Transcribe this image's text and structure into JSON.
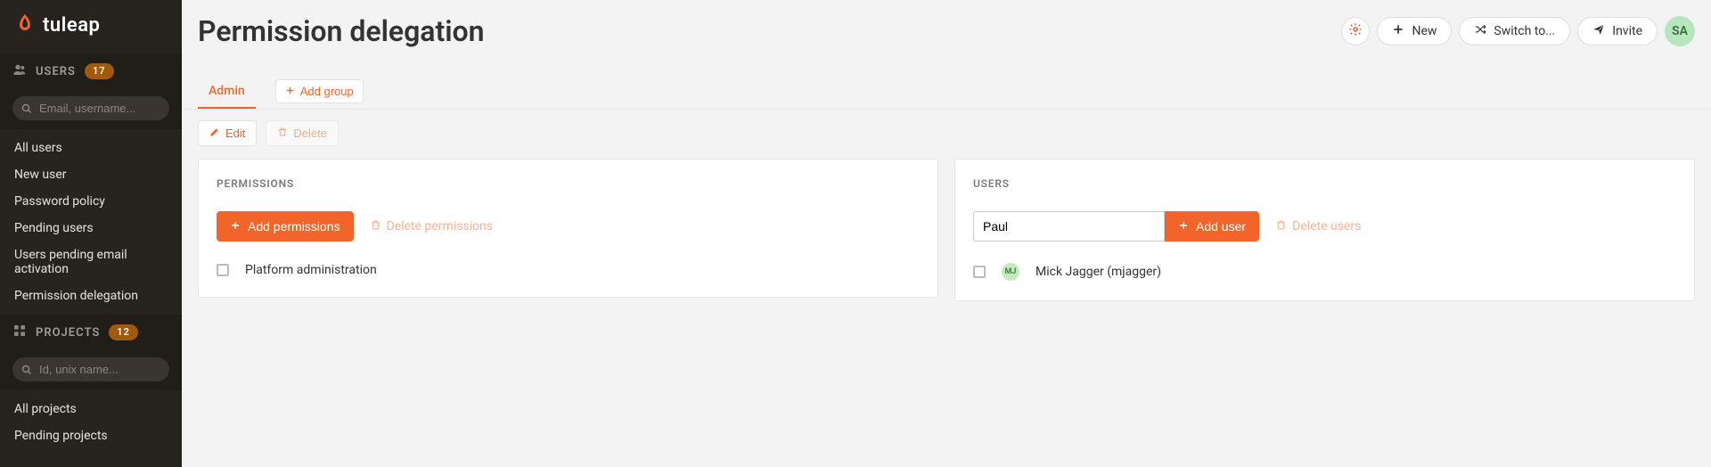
{
  "brand": {
    "name": "tuleap"
  },
  "sidebar": {
    "users": {
      "header": "USERS",
      "count": "17",
      "search_placeholder": "Email, username...",
      "links": [
        "All users",
        "New user",
        "Password policy",
        "Pending users",
        "Users pending email activation",
        "Permission delegation"
      ]
    },
    "projects": {
      "header": "PROJECTS",
      "count": "12",
      "search_placeholder": "Id, unix name...",
      "links": [
        "All projects",
        "Pending projects"
      ]
    }
  },
  "header": {
    "title": "Permission delegation",
    "new_label": "New",
    "switch_label": "Switch to...",
    "invite_label": "Invite",
    "avatar_initials": "SA"
  },
  "tabs": {
    "active": "Admin",
    "add_group": "Add group"
  },
  "toolbar": {
    "edit": "Edit",
    "delete": "Delete"
  },
  "permissions_panel": {
    "title": "PERMISSIONS",
    "add_btn": "Add permissions",
    "delete_btn": "Delete permissions",
    "rows": [
      "Platform administration"
    ]
  },
  "users_panel": {
    "title": "USERS",
    "add_btn": "Add user",
    "delete_btn": "Delete users",
    "search_value": "Paul",
    "rows": [
      {
        "initials": "MJ",
        "label": "Mick Jagger (mjagger)"
      }
    ]
  }
}
